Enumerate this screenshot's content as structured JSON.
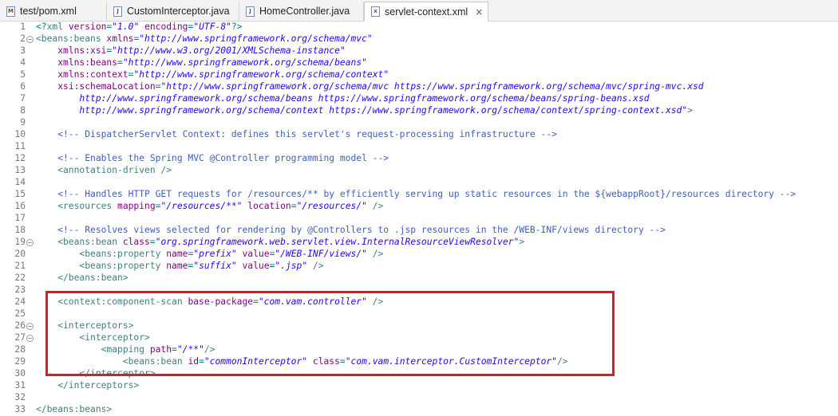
{
  "tabs": [
    {
      "label": "test/pom.xml",
      "icon": "xml-file-icon"
    },
    {
      "label": "CustomInterceptor.java",
      "icon": "java-file-icon"
    },
    {
      "label": "HomeController.java",
      "icon": "java-file-icon"
    },
    {
      "label": "servlet-context.xml",
      "icon": "xml-file-icon",
      "active": true
    }
  ],
  "close_glyph": "×",
  "editor": {
    "lines": [
      {
        "n": "1",
        "segs": [
          [
            "pun",
            "<?"
          ],
          [
            "tag",
            "xml "
          ],
          [
            "attr",
            "version"
          ],
          [
            "pun",
            "="
          ],
          [
            "val",
            "\"1.0\""
          ],
          [
            "pun",
            " "
          ],
          [
            "attr",
            "encoding"
          ],
          [
            "pun",
            "="
          ],
          [
            "val",
            "\"UTF-8\""
          ],
          [
            "pun",
            "?>"
          ]
        ]
      },
      {
        "n": "2",
        "fold": true,
        "segs": [
          [
            "tag",
            "<beans:beans "
          ],
          [
            "attr",
            "xmlns"
          ],
          [
            "pun",
            "="
          ],
          [
            "val",
            "\"http://www.springframework.org/schema/mvc\""
          ]
        ]
      },
      {
        "n": "3",
        "segs": [
          [
            "pun",
            "    "
          ],
          [
            "attr",
            "xmlns:xsi"
          ],
          [
            "pun",
            "="
          ],
          [
            "val",
            "\"http://www.w3.org/2001/XMLSchema-instance\""
          ]
        ]
      },
      {
        "n": "4",
        "segs": [
          [
            "pun",
            "    "
          ],
          [
            "attr",
            "xmlns:beans"
          ],
          [
            "pun",
            "="
          ],
          [
            "val",
            "\"http://www.springframework.org/schema/beans\""
          ]
        ]
      },
      {
        "n": "5",
        "segs": [
          [
            "pun",
            "    "
          ],
          [
            "attr",
            "xmlns:context"
          ],
          [
            "pun",
            "="
          ],
          [
            "val",
            "\"http://www.springframework.org/schema/context\""
          ]
        ]
      },
      {
        "n": "6",
        "segs": [
          [
            "pun",
            "    "
          ],
          [
            "attr",
            "xsi:schemaLocation"
          ],
          [
            "pun",
            "="
          ],
          [
            "val",
            "\"http://www.springframework.org/schema/mvc https://www.springframework.org/schema/mvc/spring-mvc.xsd"
          ]
        ]
      },
      {
        "n": "7",
        "segs": [
          [
            "val",
            "        http://www.springframework.org/schema/beans https://www.springframework.org/schema/beans/spring-beans.xsd"
          ]
        ]
      },
      {
        "n": "8",
        "segs": [
          [
            "val",
            "        http://www.springframework.org/schema/context https://www.springframework.org/schema/context/spring-context.xsd\""
          ],
          [
            "tag",
            ">"
          ]
        ]
      },
      {
        "n": "9",
        "segs": []
      },
      {
        "n": "10",
        "segs": [
          [
            "com",
            "    <!-- DispatcherServlet Context: defines this servlet's request-processing infrastructure -->"
          ]
        ]
      },
      {
        "n": "11",
        "segs": []
      },
      {
        "n": "12",
        "segs": [
          [
            "com",
            "    <!-- Enables the Spring MVC @Controller programming model -->"
          ]
        ]
      },
      {
        "n": "13",
        "segs": [
          [
            "tag",
            "    <annotation-driven />"
          ]
        ]
      },
      {
        "n": "14",
        "segs": []
      },
      {
        "n": "15",
        "segs": [
          [
            "com",
            "    <!-- Handles HTTP GET requests for /resources/** by efficiently serving up static resources in the ${webappRoot}/resources directory -->"
          ]
        ]
      },
      {
        "n": "16",
        "segs": [
          [
            "tag",
            "    <resources "
          ],
          [
            "attr",
            "mapping"
          ],
          [
            "pun",
            "="
          ],
          [
            "val",
            "\"/resources/**\""
          ],
          [
            "pun",
            " "
          ],
          [
            "attr",
            "location"
          ],
          [
            "pun",
            "="
          ],
          [
            "val",
            "\"/resources/\""
          ],
          [
            "tag",
            " />"
          ]
        ]
      },
      {
        "n": "17",
        "segs": []
      },
      {
        "n": "18",
        "segs": [
          [
            "com",
            "    <!-- Resolves views selected for rendering by @Controllers to .jsp resources in the /WEB-INF/views directory -->"
          ]
        ]
      },
      {
        "n": "19",
        "fold": true,
        "segs": [
          [
            "tag",
            "    <beans:bean "
          ],
          [
            "attr",
            "class"
          ],
          [
            "pun",
            "="
          ],
          [
            "val",
            "\"org.springframework.web.servlet.view.InternalResourceViewResolver\""
          ],
          [
            "tag",
            ">"
          ]
        ]
      },
      {
        "n": "20",
        "segs": [
          [
            "tag",
            "        <beans:property "
          ],
          [
            "attr",
            "name"
          ],
          [
            "pun",
            "="
          ],
          [
            "val",
            "\"prefix\""
          ],
          [
            "pun",
            " "
          ],
          [
            "attr",
            "value"
          ],
          [
            "pun",
            "="
          ],
          [
            "val",
            "\"/WEB-INF/views/\""
          ],
          [
            "tag",
            " />"
          ]
        ]
      },
      {
        "n": "21",
        "segs": [
          [
            "tag",
            "        <beans:property "
          ],
          [
            "attr",
            "name"
          ],
          [
            "pun",
            "="
          ],
          [
            "val",
            "\"suffix\""
          ],
          [
            "pun",
            " "
          ],
          [
            "attr",
            "value"
          ],
          [
            "pun",
            "="
          ],
          [
            "val",
            "\".jsp\""
          ],
          [
            "tag",
            " />"
          ]
        ]
      },
      {
        "n": "22",
        "segs": [
          [
            "tag",
            "    </beans:bean>"
          ]
        ]
      },
      {
        "n": "23",
        "segs": []
      },
      {
        "n": "24",
        "segs": [
          [
            "tag",
            "    <context:component-scan "
          ],
          [
            "attr",
            "base-package"
          ],
          [
            "pun",
            "="
          ],
          [
            "val",
            "\"com.vam.controller\""
          ],
          [
            "tag",
            " />"
          ]
        ]
      },
      {
        "n": "25",
        "segs": []
      },
      {
        "n": "26",
        "fold": true,
        "segs": [
          [
            "tag",
            "    <interceptors>"
          ]
        ]
      },
      {
        "n": "27",
        "fold": true,
        "segs": [
          [
            "tag",
            "        <interceptor>"
          ]
        ]
      },
      {
        "n": "28",
        "segs": [
          [
            "tag",
            "            <mapping "
          ],
          [
            "attr",
            "path"
          ],
          [
            "pun",
            "="
          ],
          [
            "val",
            "\"/**\""
          ],
          [
            "tag",
            "/>"
          ]
        ]
      },
      {
        "n": "29",
        "segs": [
          [
            "tag",
            "                <beans:bean "
          ],
          [
            "attr",
            "id"
          ],
          [
            "pun",
            "="
          ],
          [
            "val",
            "\"commonInterceptor\""
          ],
          [
            "pun",
            " "
          ],
          [
            "attr",
            "class"
          ],
          [
            "pun",
            "="
          ],
          [
            "val",
            "\"com.vam.interceptor.CustomInterceptor\""
          ],
          [
            "tag",
            "/>"
          ]
        ]
      },
      {
        "n": "30",
        "segs": [
          [
            "tag",
            "        </interceptor>"
          ]
        ]
      },
      {
        "n": "31",
        "segs": [
          [
            "tag",
            "    </interceptors>"
          ]
        ]
      },
      {
        "n": "32",
        "segs": []
      },
      {
        "n": "33",
        "segs": [
          [
            "tag",
            "</beans:beans>"
          ]
        ]
      }
    ]
  },
  "highlight": {
    "color": "#e01a24"
  }
}
